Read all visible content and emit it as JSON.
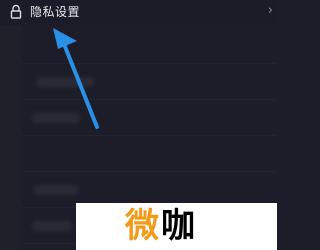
{
  "header": {
    "title": "隐私设置",
    "lock_icon": "lock-icon",
    "chevron": "›"
  },
  "list": {
    "rows": 6
  },
  "annotation": {
    "arrow_color": "#2a8fe6",
    "icon": "arrow-up-icon"
  },
  "watermark": {
    "char1": "微",
    "char2": "咖",
    "accent": "#f39b19"
  }
}
